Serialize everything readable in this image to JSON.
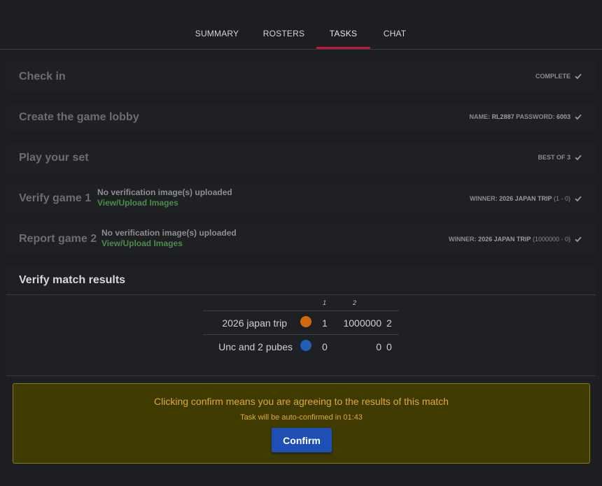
{
  "tabs": [
    {
      "label": "SUMMARY"
    },
    {
      "label": "ROSTERS"
    },
    {
      "label": "TASKS"
    },
    {
      "label": "CHAT"
    }
  ],
  "active_tab": "TASKS",
  "tasks": {
    "check_in": {
      "title": "Check in",
      "status": "COMPLETE"
    },
    "create_lobby": {
      "title": "Create the game lobby",
      "name_label": "NAME:",
      "name_value": "RL2887",
      "password_label": "PASSWORD:",
      "password_value": "6003"
    },
    "play_set": {
      "title": "Play your set",
      "status": "BEST OF 3"
    },
    "verify_game_1": {
      "title": "Verify game 1",
      "no_images": "No verification image(s) uploaded",
      "link": "View/Upload Images",
      "winner_label": "WINNER:",
      "winner_name": "2026 JAPAN TRIP",
      "score": "(1 - 0)"
    },
    "report_game_2": {
      "title": "Report game 2",
      "no_images": "No verification image(s) uploaded",
      "link": "View/Upload Images",
      "winner_label": "WINNER:",
      "winner_name": "2026 JAPAN TRIP",
      "score": "(1000000 - 0)"
    }
  },
  "verify_results": {
    "title": "Verify match results",
    "game_headers": [
      "1",
      "2"
    ],
    "teams": [
      {
        "name": "2026 japan trip",
        "color": "#d4690a",
        "game1": "1",
        "game2": "1000000",
        "total": "2"
      },
      {
        "name": "Unc and 2 pubes",
        "color": "#1f5fb5",
        "game1": "0",
        "game2": "0",
        "total": "0"
      }
    ]
  },
  "confirm": {
    "message": "Clicking confirm means you are agreeing to the results of this match",
    "timer": "Task will be auto-confirmed in 01:43",
    "button_label": "Confirm"
  },
  "colors": {
    "accent": "#c0163c",
    "link": "#4a8c4a",
    "warning_bg": "#3f3b00",
    "warning_text": "#e0a93a",
    "button": "#1e4fb4"
  },
  "icons": {
    "check": "check-icon"
  }
}
